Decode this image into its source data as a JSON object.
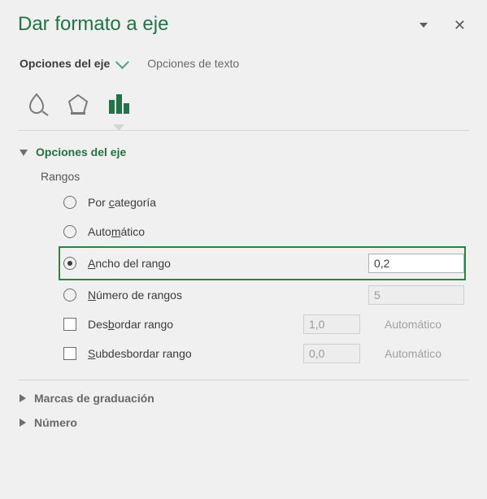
{
  "title": "Dar formato a eje",
  "tabs": {
    "axis_options": "Opciones del eje",
    "text_options": "Opciones de texto"
  },
  "section": {
    "axis_options_title": "Opciones del eje",
    "bins_label": "Rangos",
    "radios": {
      "by_category": "Por categoría",
      "automatic": "Automático",
      "bin_width": "Ancho del rango",
      "num_bins": "Número de rangos"
    },
    "underlines": {
      "by_category": "c",
      "automatic": "m",
      "bin_width": "A",
      "num_bins": "N",
      "overflow": "b",
      "underflow": "S"
    },
    "checks": {
      "overflow": "Desbordar rango",
      "underflow": "Subdesbordar rango"
    },
    "values": {
      "bin_width": "0,2",
      "num_bins": "5",
      "overflow": "1,0",
      "underflow": "0,0"
    },
    "auto_text": "Automático"
  },
  "collapsed": {
    "ticks": "Marcas de graduación",
    "number": "Número"
  }
}
